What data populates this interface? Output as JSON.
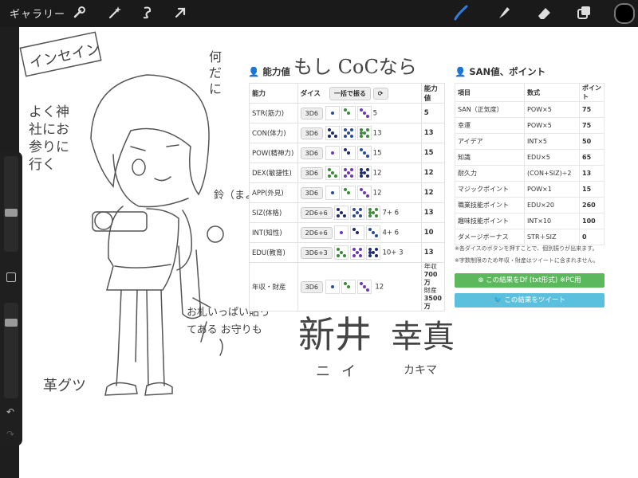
{
  "app": {
    "gallery_label": "ギャラリー",
    "toolbar_icons": [
      "wrench-icon",
      "magic-wand-icon",
      "selection-icon",
      "transform-arrow-icon"
    ],
    "tool_icons": [
      "brush-icon",
      "smudge-icon",
      "eraser-icon",
      "layers-icon",
      "color-swatch"
    ],
    "accent": "#2f7de1"
  },
  "stats": {
    "title": "能力値",
    "col_ability": "能力",
    "col_dice": "ダイス",
    "roll_all": "一括で振る",
    "col_value": "能力値",
    "rows": [
      {
        "name": "STR(筋力)",
        "dice": "3D6",
        "extra": "5",
        "value": "5"
      },
      {
        "name": "CON(体力)",
        "dice": "3D6",
        "extra": "13",
        "value": "13"
      },
      {
        "name": "POW(精神力)",
        "dice": "3D6",
        "extra": "15",
        "value": "15"
      },
      {
        "name": "DEX(敏捷性)",
        "dice": "3D6",
        "extra": "12",
        "value": "12"
      },
      {
        "name": "APP(外見)",
        "dice": "3D6",
        "extra": "12",
        "value": "12"
      },
      {
        "name": "SIZ(体格)",
        "dice": "2D6+6",
        "extra": "7+ 6",
        "value": "13"
      },
      {
        "name": "INT(知性)",
        "dice": "2D6+6",
        "extra": "4+ 6",
        "value": "10"
      },
      {
        "name": "EDU(教育)",
        "dice": "3D6+3",
        "extra": "10+ 3",
        "value": "13"
      }
    ],
    "income": {
      "name": "年収・財産",
      "dice": "3D6",
      "extra": "12",
      "value_line1": "年収",
      "value_line2": "700万",
      "value_line3": "財産",
      "value_line4": "3500万"
    }
  },
  "san": {
    "title": "SAN値、ポイント",
    "col_item": "項目",
    "col_formula": "数式",
    "col_point": "ポイント",
    "rows": [
      {
        "item": "SAN（正気度）",
        "formula": "POW×5",
        "point": "75"
      },
      {
        "item": "幸運",
        "formula": "POW×5",
        "point": "75"
      },
      {
        "item": "アイデア",
        "formula": "INT×5",
        "point": "50"
      },
      {
        "item": "知識",
        "formula": "EDU×5",
        "point": "65"
      },
      {
        "item": "耐久力",
        "formula": "(CON+SIZ)÷2",
        "point": "13"
      },
      {
        "item": "マジックポイント",
        "formula": "POW×1",
        "point": "15"
      },
      {
        "item": "職業技能ポイント",
        "formula": "EDU×20",
        "point": "260"
      },
      {
        "item": "趣味技能ポイント",
        "formula": "INT×10",
        "point": "100"
      },
      {
        "item": "ダメージボーナス",
        "formula": "STR＋SIZ",
        "point": "0"
      }
    ],
    "note1": "※各ダイスのボタンを押すことで、個別振りが出来ます。",
    "note2": "※字数制限のため年収・財産はツイートに含まれません。",
    "button_pc": "この結果をDf (txt形式) ※PC用",
    "button_tweet": "この結果をツイート"
  },
  "handwriting": {
    "insane": "インセイン",
    "what": "何だに",
    "moshi": "もし CoCなら",
    "shrine": "よく神社にお参りに行く",
    "bell": "鈴（まよけ）",
    "omamori": "お札いっぱい貼ってある お守りも",
    "shoes": "革グツ",
    "name_sei": "新井",
    "name_mei": "幸真",
    "kana_sei": "ニイ",
    "kana_mei": "カキマ"
  }
}
